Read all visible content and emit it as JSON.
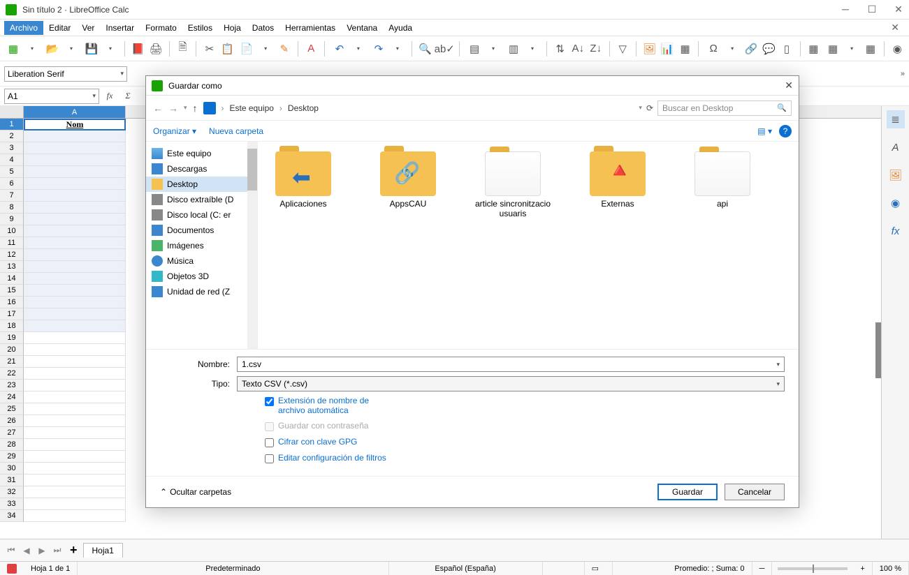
{
  "window": {
    "title": "Sin título 2 · LibreOffice Calc"
  },
  "menu": {
    "items": [
      "Archivo",
      "Editar",
      "Ver",
      "Insertar",
      "Formato",
      "Estilos",
      "Hoja",
      "Datos",
      "Herramientas",
      "Ventana",
      "Ayuda"
    ],
    "active": 0
  },
  "toolbar2": {
    "font": "Liberation Serif"
  },
  "namebox": {
    "ref": "A1"
  },
  "sheet": {
    "col_header": "A",
    "row_count": 34,
    "cell_A1": "Nom"
  },
  "tabs": {
    "sheet_name": "Hoja1"
  },
  "statusbar": {
    "sheet_of": "Hoja 1 de 1",
    "style": "Predeterminado",
    "language": "Español (España)",
    "stats": "Promedio: ; Suma: 0",
    "zoom": "100 %"
  },
  "dialog": {
    "title": "Guardar como",
    "breadcrumbs": [
      "Este equipo",
      "Desktop"
    ],
    "search_placeholder": "Buscar en Desktop",
    "organize": "Organizar",
    "new_folder": "Nueva carpeta",
    "tree": [
      {
        "label": "Este equipo",
        "icon": "pc"
      },
      {
        "label": "Descargas",
        "icon": "dl"
      },
      {
        "label": "Desktop",
        "icon": "fw",
        "selected": true
      },
      {
        "label": "Disco extraíble (D",
        "icon": "disk"
      },
      {
        "label": "Disco local (C: er",
        "icon": "disk"
      },
      {
        "label": "Documentos",
        "icon": "doc"
      },
      {
        "label": "Imágenes",
        "icon": "img"
      },
      {
        "label": "Música",
        "icon": "mus"
      },
      {
        "label": "Objetos 3D",
        "icon": "obj"
      },
      {
        "label": "Unidad de red (Z",
        "icon": "net"
      }
    ],
    "files": [
      {
        "name": "Aplicaciones",
        "kind": "blue-arrow"
      },
      {
        "name": "AppsCAU",
        "kind": "green"
      },
      {
        "name": "article sincronitzacio usuaris",
        "kind": "paper"
      },
      {
        "name": "Externas",
        "kind": "cone"
      },
      {
        "name": "api",
        "kind": "paper"
      }
    ],
    "name_label": "Nombre:",
    "name_value": "1.csv",
    "type_label": "Tipo:",
    "type_value": "Texto CSV (*.csv)",
    "cb_auto_ext": "Extensión de nombre de archivo automática",
    "cb_password": "Guardar con contraseña",
    "cb_gpg": "Cifrar con clave GPG",
    "cb_filter": "Editar configuración de filtros",
    "hide_folders": "Ocultar carpetas",
    "save_btn": "Guardar",
    "cancel_btn": "Cancelar"
  }
}
